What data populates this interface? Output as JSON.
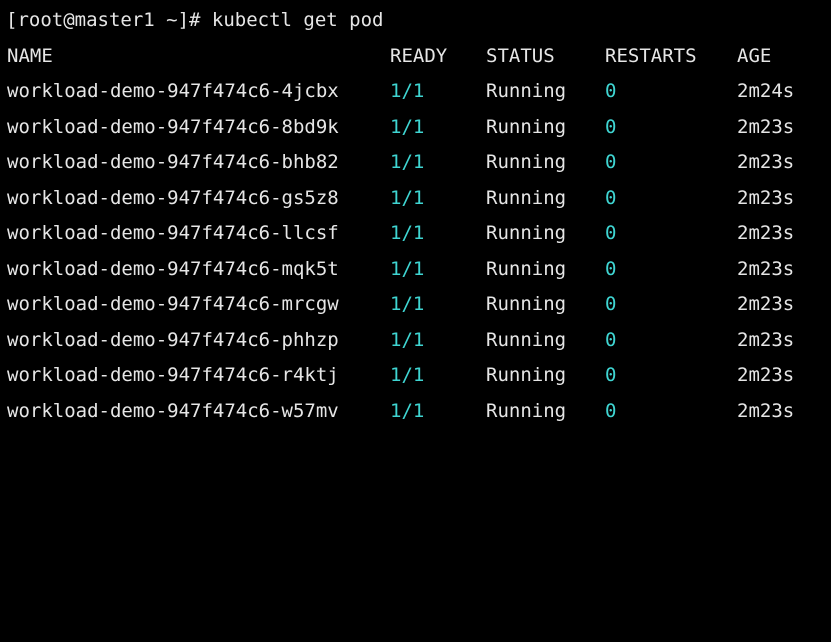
{
  "terminal": {
    "prompt": "[root@master1 ~]# ",
    "command": "kubectl get pod",
    "colors": {
      "background": "#000000",
      "text": "#e6e6e6",
      "accent": "#3fd5d2"
    },
    "headers": {
      "name": "NAME",
      "ready": "READY",
      "status": "STATUS",
      "restarts": "RESTARTS",
      "age": "AGE"
    },
    "rows": [
      {
        "name": "workload-demo-947f474c6-4jcbx",
        "ready": "1/1",
        "status": "Running",
        "restarts": "0",
        "age": "2m24s"
      },
      {
        "name": "workload-demo-947f474c6-8bd9k",
        "ready": "1/1",
        "status": "Running",
        "restarts": "0",
        "age": "2m23s"
      },
      {
        "name": "workload-demo-947f474c6-bhb82",
        "ready": "1/1",
        "status": "Running",
        "restarts": "0",
        "age": "2m23s"
      },
      {
        "name": "workload-demo-947f474c6-gs5z8",
        "ready": "1/1",
        "status": "Running",
        "restarts": "0",
        "age": "2m23s"
      },
      {
        "name": "workload-demo-947f474c6-llcsf",
        "ready": "1/1",
        "status": "Running",
        "restarts": "0",
        "age": "2m23s"
      },
      {
        "name": "workload-demo-947f474c6-mqk5t",
        "ready": "1/1",
        "status": "Running",
        "restarts": "0",
        "age": "2m23s"
      },
      {
        "name": "workload-demo-947f474c6-mrcgw",
        "ready": "1/1",
        "status": "Running",
        "restarts": "0",
        "age": "2m23s"
      },
      {
        "name": "workload-demo-947f474c6-phhzp",
        "ready": "1/1",
        "status": "Running",
        "restarts": "0",
        "age": "2m23s"
      },
      {
        "name": "workload-demo-947f474c6-r4ktj",
        "ready": "1/1",
        "status": "Running",
        "restarts": "0",
        "age": "2m23s"
      },
      {
        "name": "workload-demo-947f474c6-w57mv",
        "ready": "1/1",
        "status": "Running",
        "restarts": "0",
        "age": "2m23s"
      }
    ]
  }
}
